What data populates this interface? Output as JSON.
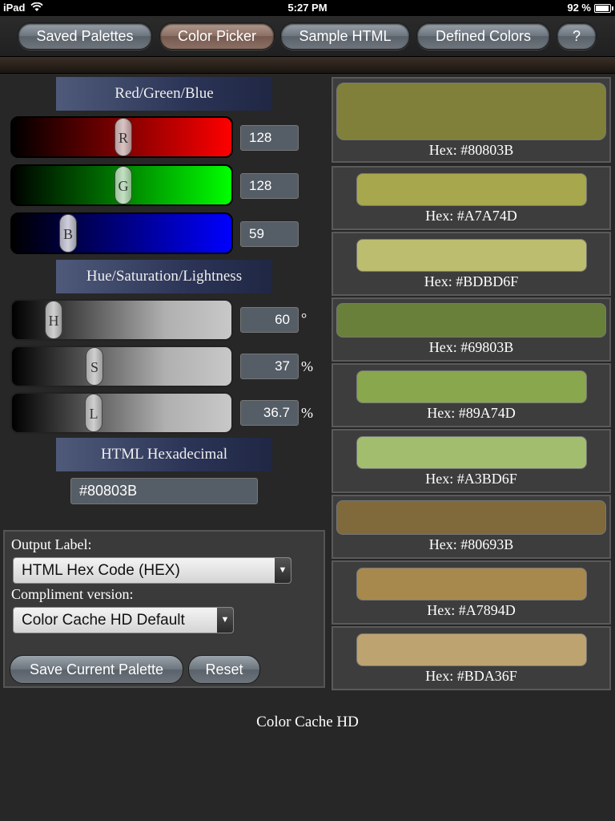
{
  "status": {
    "carrier": "iPad",
    "time": "5:27 PM",
    "battery": "92 %"
  },
  "nav": {
    "tabs": [
      "Saved Palettes",
      "Color Picker",
      "Sample HTML",
      "Defined Colors",
      "?"
    ],
    "active": "Color Picker"
  },
  "rgb": {
    "header": "Red/Green/Blue",
    "r_label": "R",
    "g_label": "G",
    "b_label": "B",
    "r": "128",
    "g": "128",
    "b": "59"
  },
  "hsl": {
    "header": "Hue/Saturation/Lightness",
    "h_label": "H",
    "s_label": "S",
    "l_label": "L",
    "h": "60",
    "s": "37",
    "l": "36.7",
    "h_unit": "°",
    "s_unit": "%",
    "l_unit": "%"
  },
  "hex": {
    "header": "HTML Hexadecimal",
    "value": "#80803B"
  },
  "options": {
    "output_label": "Output Label:",
    "output_value": "HTML Hex Code (HEX)",
    "compliment_label": "Compliment version:",
    "compliment_value": "Color Cache HD Default",
    "save_button": "Save Current Palette",
    "reset_button": "Reset"
  },
  "swatches": [
    {
      "color": "#80803B",
      "label": "Hex: #80803B"
    },
    {
      "color": "#A7A74D",
      "label": "Hex: #A7A74D"
    },
    {
      "color": "#BDBD6F",
      "label": "Hex: #BDBD6F"
    },
    {
      "color": "#69803B",
      "label": "Hex: #69803B"
    },
    {
      "color": "#89A74D",
      "label": "Hex: #89A74D"
    },
    {
      "color": "#A3BD6F",
      "label": "Hex: #A3BD6F"
    },
    {
      "color": "#80693B",
      "label": "Hex: #80693B"
    },
    {
      "color": "#A7894D",
      "label": "Hex: #A7894D"
    },
    {
      "color": "#BDA36F",
      "label": "Hex: #BDA36F"
    }
  ],
  "footer": "Color Cache HD"
}
